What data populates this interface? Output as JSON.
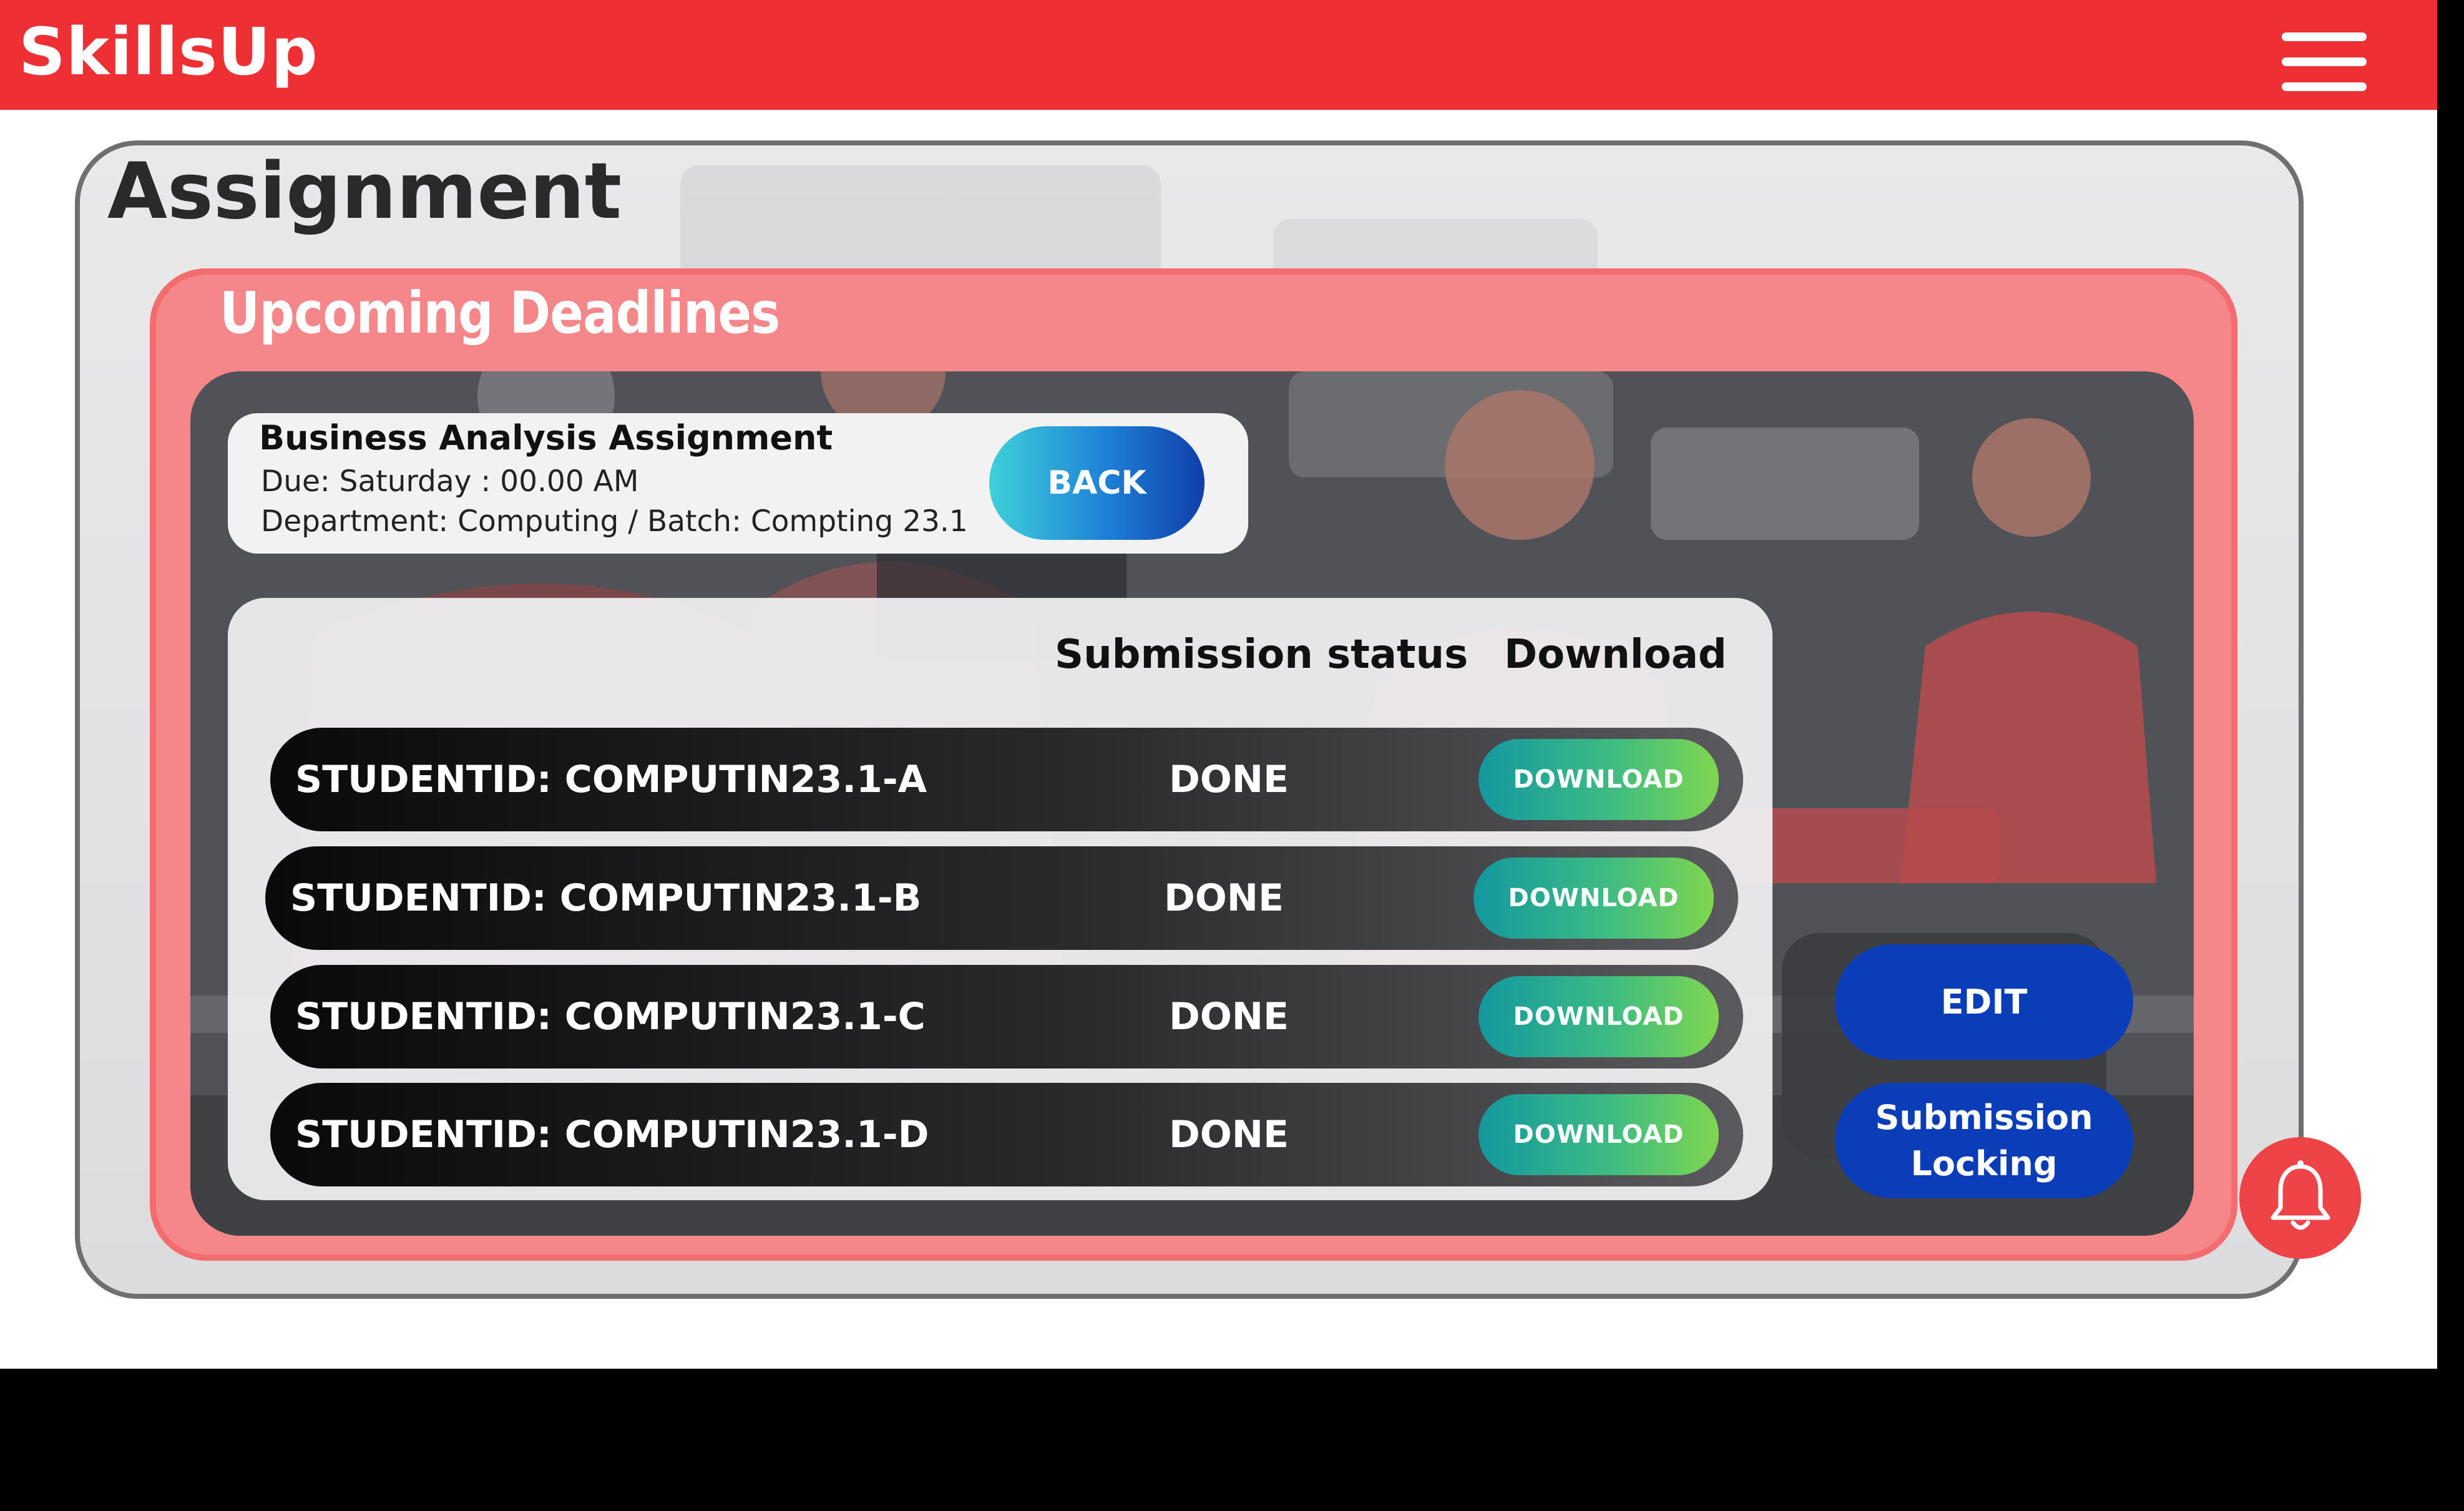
{
  "app": {
    "brand": "SkillsUp",
    "menu_icon": "hamburger-menu-icon"
  },
  "page": {
    "title": "Assignment",
    "section_title": "Upcoming Deadlines"
  },
  "assignment": {
    "title": "Business Analysis Assignment",
    "due": "Due: Saturday : 00.00 AM",
    "department": "Department: Computing / Batch: Compting 23.1",
    "back_label": "BACK"
  },
  "table": {
    "headers": {
      "status": "Submission status",
      "download": "Download"
    },
    "rows": [
      {
        "student": "STUDENTID: COMPUTIN23.1-A",
        "status": "DONE",
        "action": "DOWNLOAD"
      },
      {
        "student": "STUDENTID: COMPUTIN23.1-B",
        "status": "DONE",
        "action": "DOWNLOAD"
      },
      {
        "student": "STUDENTID: COMPUTIN23.1-C",
        "status": "DONE",
        "action": "DOWNLOAD"
      },
      {
        "student": "STUDENTID: COMPUTIN23.1-D",
        "status": "DONE",
        "action": "DOWNLOAD"
      }
    ]
  },
  "actions": {
    "edit_label": "EDIT",
    "lock_label_line1": "Submission",
    "lock_label_line2": "Locking",
    "bell_icon": "bell-icon"
  },
  "colors": {
    "brand_red": "#ee3034",
    "frame_pink": "#f5878a",
    "primary_blue": "#0b3db8",
    "download_green": "#3dbb83"
  }
}
